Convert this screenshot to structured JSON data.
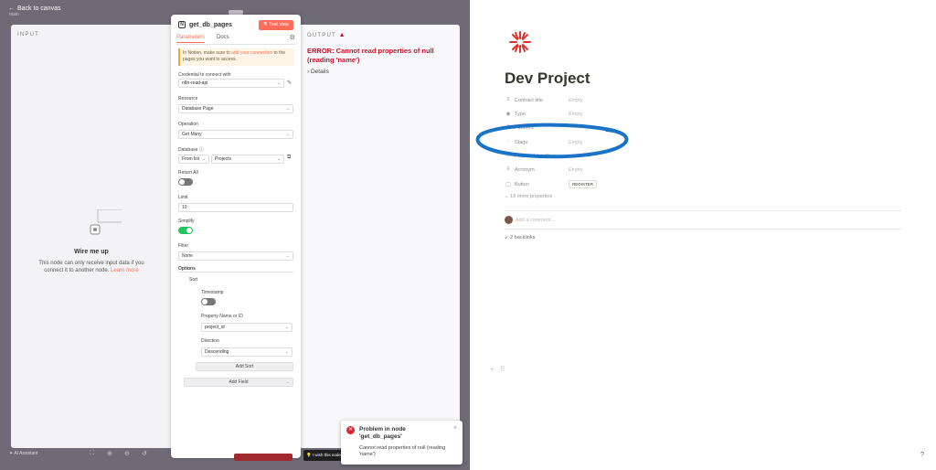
{
  "colors": {
    "accent": "#ff6d5a",
    "error": "#c8102e",
    "notion_text": "#37352f",
    "annotation": "#1a73c7",
    "logo": "#e0342e"
  },
  "n8n": {
    "back_label": "Back to canvas",
    "ghost_label": "main",
    "input": {
      "title": "INPUT",
      "wire_title": "Wire me up",
      "wire_desc": "This node can only receive input data if you connect it to another node.",
      "learn_more": "Learn more"
    },
    "output": {
      "title": "OUTPUT",
      "error": "ERROR: Cannot read properties of null (reading 'name')",
      "details": "Details"
    },
    "node": {
      "name": "get_db_pages",
      "test_step": "Test step",
      "tabs": [
        "Parameters",
        "Docs"
      ],
      "notice_pre": "In Notion, make sure to ",
      "notice_link": "add your connection",
      "notice_post": " to the pages you want to access.",
      "credential_label": "Credential to connect with",
      "credential_value": "n8n-read-api",
      "resource_label": "Resource",
      "resource_value": "Database Page",
      "operation_label": "Operation",
      "operation_value": "Get Many",
      "database_label": "Database",
      "database_mode": "From list",
      "database_value": "Projects",
      "return_all_label": "Return All",
      "return_all": false,
      "limit_label": "Limit",
      "limit_value": "10",
      "simplify_label": "Simplify",
      "simplify": true,
      "filter_label": "Filter",
      "filter_value": "None",
      "options_label": "Options",
      "sort_label": "Sort",
      "timestamp_label": "Timestamp",
      "timestamp": false,
      "property_label": "Property Name or ID",
      "property_value": "project_id",
      "direction_label": "Direction",
      "direction_value": "Descending",
      "add_sort": "Add Sort",
      "add_field": "Add Field"
    },
    "toast": {
      "title": "Problem in node 'get_db_pages'",
      "message": "Cannot read properties of null (reading 'name')"
    },
    "bottom": {
      "assistant": "AI Assistant",
      "wish": "I wish this node"
    }
  },
  "notion": {
    "title": "Dev Project",
    "properties": [
      {
        "icon": "list-icon",
        "glyph": "≡",
        "name": "Contract title",
        "value": "Empty"
      },
      {
        "icon": "type-icon",
        "glyph": "◉",
        "name": "Type",
        "value": "Empty"
      },
      {
        "icon": "partners-icon",
        "glyph": "≡",
        "name": "Partners",
        "value": ""
      },
      {
        "icon": "stage-icon",
        "glyph": "◌",
        "name": "Stage",
        "value": "Empty"
      },
      {
        "icon": "proposal-icon",
        "glyph": "≡",
        "name": "Proposal deadline",
        "value": ""
      },
      {
        "icon": "acronym-icon",
        "glyph": "≡",
        "name": "Acronym",
        "value": "Empty"
      },
      {
        "icon": "button-icon",
        "glyph": "▢",
        "name": "Button",
        "value": "REGISTER"
      }
    ],
    "more_properties": "18 more properties",
    "comment_placeholder": "Add a comment...",
    "backlinks": "2 backlinks",
    "help": "?"
  }
}
